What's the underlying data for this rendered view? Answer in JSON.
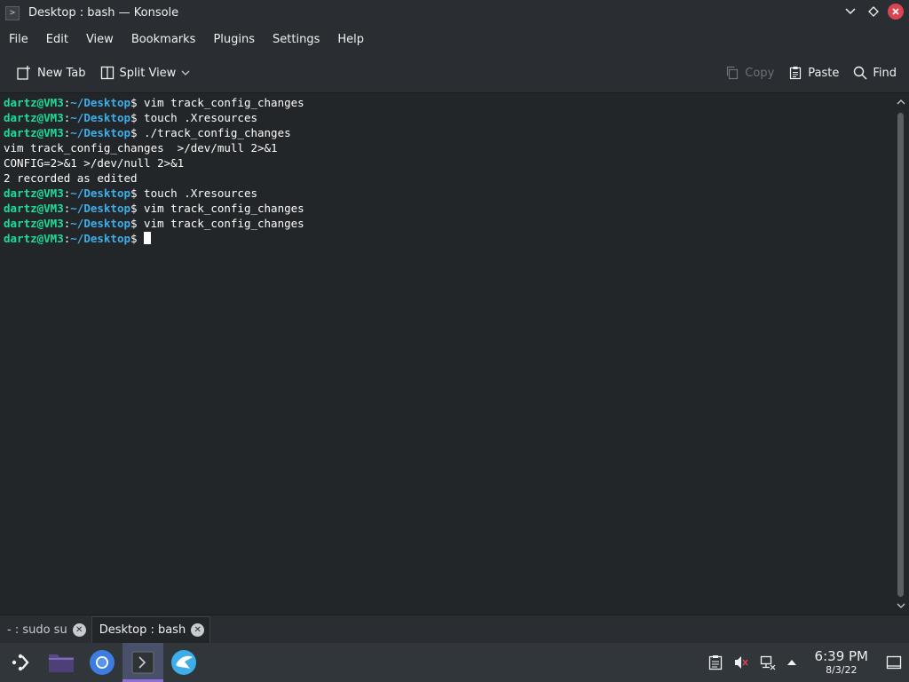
{
  "window": {
    "title": "Desktop : bash — Konsole",
    "icon_glyph": ">"
  },
  "window_controls": {
    "minimize": "⌵",
    "maximize": "◇",
    "close": "✕"
  },
  "menu": [
    "File",
    "Edit",
    "View",
    "Bookmarks",
    "Plugins",
    "Settings",
    "Help"
  ],
  "toolbar": {
    "new_tab": "New Tab",
    "split_view": "Split View",
    "copy": "Copy",
    "paste": "Paste",
    "find": "Find"
  },
  "terminal": {
    "prompt_user": "dartz@VM3",
    "prompt_path": "~/Desktop",
    "lines": [
      {
        "type": "prompt",
        "cmd": " vim track_config_changes"
      },
      {
        "type": "prompt",
        "cmd": " touch .Xresources"
      },
      {
        "type": "prompt",
        "cmd": " ./track_config_changes"
      },
      {
        "type": "output",
        "text": "vim track_config_changes  >/dev/mull 2>&1"
      },
      {
        "type": "output",
        "text": "CONFIG=2>&1 >/dev/null 2>&1"
      },
      {
        "type": "output",
        "text": "2 recorded as edited"
      },
      {
        "type": "prompt",
        "cmd": " touch .Xresources"
      },
      {
        "type": "prompt",
        "cmd": " vim track_config_changes"
      },
      {
        "type": "prompt",
        "cmd": " vim track_config_changes"
      },
      {
        "type": "prompt",
        "cmd": " ",
        "cursor": true
      }
    ]
  },
  "tabs": [
    {
      "label": "- : sudo su",
      "active": false
    },
    {
      "label": "Desktop : bash",
      "active": true
    }
  ],
  "taskbar": {
    "apps": [
      "application-launcher-icon",
      "file-manager-icon",
      "chromium-icon",
      "konsole-icon",
      "krdc-icon"
    ],
    "time": "6:39 PM",
    "date": "8/3/22"
  },
  "colors": {
    "prompt_user": "#1cdc9a",
    "prompt_path": "#3daee9",
    "background": "#232629",
    "close_button": "#da4453"
  }
}
